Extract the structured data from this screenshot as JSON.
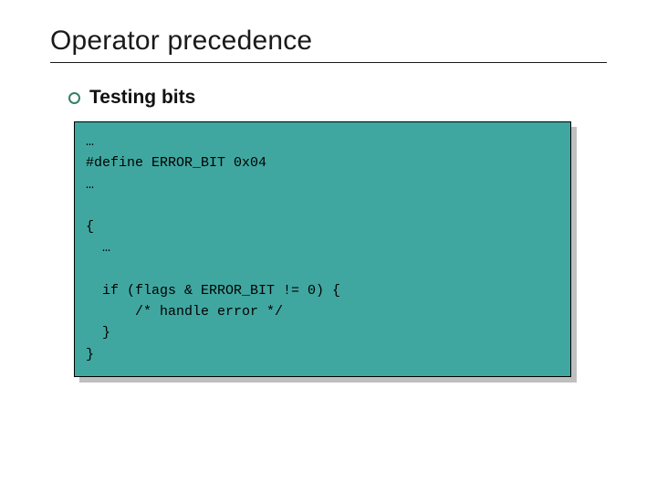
{
  "slide": {
    "title": "Operator precedence",
    "bullet": "Testing bits",
    "code": "…\n#define ERROR_BIT 0x04\n…\n\n{\n  …\n\n  if (flags & ERROR_BIT != 0) {\n      /* handle error */\n  }\n}"
  },
  "colors": {
    "codebox_bg": "#3fa7a0",
    "bullet_ring": "#338066",
    "shadow": "#bfbfbf"
  }
}
